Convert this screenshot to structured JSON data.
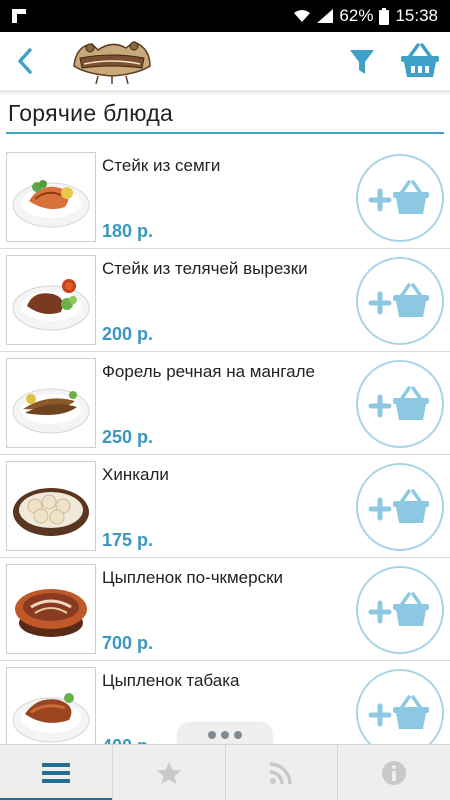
{
  "status_bar": {
    "battery": "62%",
    "time": "15:38",
    "icons": [
      "notification-icon",
      "wifi-icon",
      "signal-icon",
      "battery-icon"
    ]
  },
  "header": {
    "back_icon": "chevron-left-icon",
    "logo": "restaurant-logo",
    "filter_icon": "filter-funnel-icon",
    "basket_icon": "basket-icon"
  },
  "section": {
    "title": "Горячие блюда"
  },
  "items": [
    {
      "name": "Стейк из семги",
      "price": "180 р."
    },
    {
      "name": "Стейк из телячей вырезки",
      "price": "200 р."
    },
    {
      "name": "Форель речная на мангале",
      "price": "250 р."
    },
    {
      "name": "Хинкали",
      "price": "175 р."
    },
    {
      "name": "Цыпленок по-чкмерски",
      "price": "700 р."
    },
    {
      "name": "Цыпленок табака",
      "price": "400 р."
    }
  ],
  "tabs": [
    {
      "icon": "menu-list-icon",
      "active": true
    },
    {
      "icon": "star-icon",
      "active": false
    },
    {
      "icon": "rss-icon",
      "active": false
    },
    {
      "icon": "info-icon",
      "active": false
    }
  ],
  "colors": {
    "accent": "#3fa1c8",
    "price": "#3a97bf",
    "add_button_border": "#a8d4e8",
    "active_tab": "#1f6f96"
  }
}
